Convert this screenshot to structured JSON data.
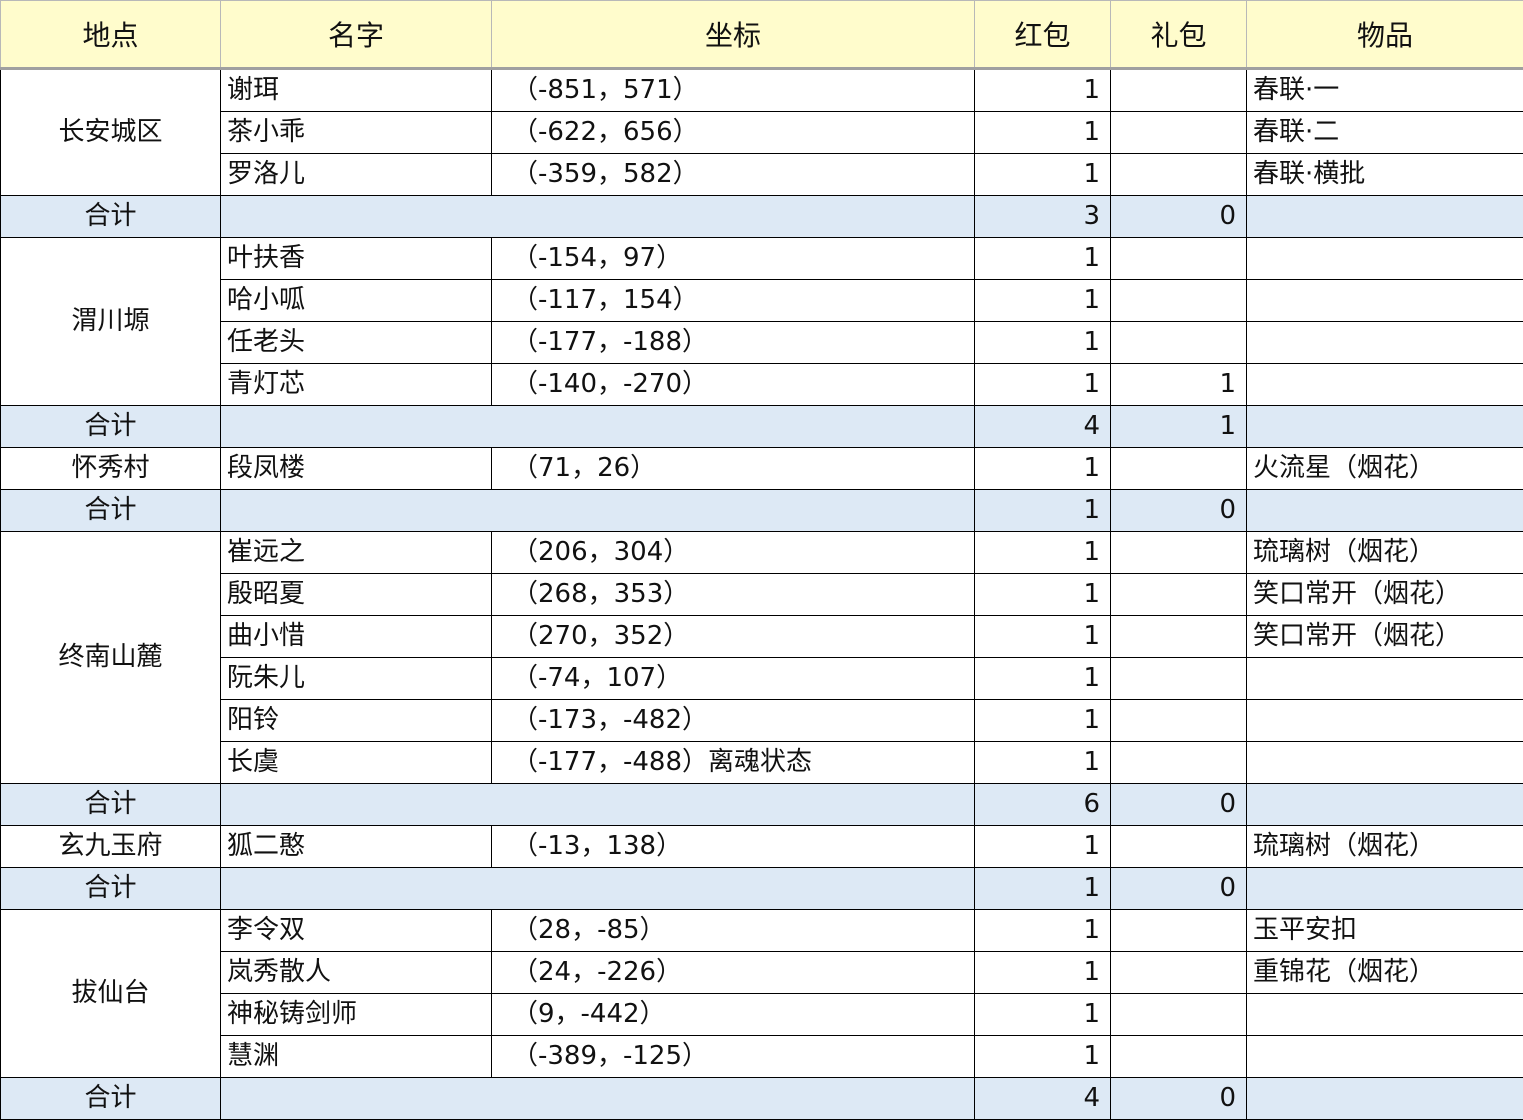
{
  "headers": {
    "location": "地点",
    "name": "名字",
    "coords": "坐标",
    "hongbao": "红包",
    "libao": "礼包",
    "item": "物品"
  },
  "total_label": "合计",
  "colors": {
    "header_bg": "#fffccc",
    "total_bg": "#dde9f5",
    "border": "#000000"
  },
  "groups": [
    {
      "location": "长安城区",
      "rows": [
        {
          "name": "谢珥",
          "coords": "（-851，571）",
          "hongbao": "1",
          "libao": "",
          "item": "春联·一"
        },
        {
          "name": "茶小乖",
          "coords": "（-622，656）",
          "hongbao": "1",
          "libao": "",
          "item": "春联·二"
        },
        {
          "name": "罗洛儿",
          "coords": "（-359，582）",
          "hongbao": "1",
          "libao": "",
          "item": "春联·横批"
        }
      ],
      "total": {
        "hongbao": "3",
        "libao": "0"
      }
    },
    {
      "location": "渭川塬",
      "rows": [
        {
          "name": "叶扶香",
          "coords": "（-154，97）",
          "hongbao": "1",
          "libao": "",
          "item": ""
        },
        {
          "name": "哈小呱",
          "coords": "（-117，154）",
          "hongbao": "1",
          "libao": "",
          "item": ""
        },
        {
          "name": "任老头",
          "coords": "（-177，-188）",
          "hongbao": "1",
          "libao": "",
          "item": ""
        },
        {
          "name": "青灯芯",
          "coords": "（-140，-270）",
          "hongbao": "1",
          "libao": "1",
          "item": ""
        }
      ],
      "total": {
        "hongbao": "4",
        "libao": "1"
      }
    },
    {
      "location": "怀秀村",
      "rows": [
        {
          "name": "段凤楼",
          "coords": "（71，26）",
          "hongbao": "1",
          "libao": "",
          "item": "火流星（烟花）"
        }
      ],
      "total": {
        "hongbao": "1",
        "libao": "0"
      }
    },
    {
      "location": "终南山麓",
      "rows": [
        {
          "name": "崔远之",
          "coords": "（206，304）",
          "hongbao": "1",
          "libao": "",
          "item": "琉璃树（烟花）"
        },
        {
          "name": "殷昭夏",
          "coords": "（268，353）",
          "hongbao": "1",
          "libao": "",
          "item": "笑口常开（烟花）"
        },
        {
          "name": "曲小惜",
          "coords": "（270，352）",
          "hongbao": "1",
          "libao": "",
          "item": "笑口常开（烟花）"
        },
        {
          "name": "阮朱儿",
          "coords": "（-74，107）",
          "hongbao": "1",
          "libao": "",
          "item": ""
        },
        {
          "name": "阳铃",
          "coords": "（-173，-482）",
          "hongbao": "1",
          "libao": "",
          "item": ""
        },
        {
          "name": "长虞",
          "coords": "（-177，-488）离魂状态",
          "hongbao": "1",
          "libao": "",
          "item": ""
        }
      ],
      "total": {
        "hongbao": "6",
        "libao": "0"
      }
    },
    {
      "location": "玄九玉府",
      "rows": [
        {
          "name": "狐二憨",
          "coords": "（-13，138）",
          "hongbao": "1",
          "libao": "",
          "item": "琉璃树（烟花）"
        }
      ],
      "total": {
        "hongbao": "1",
        "libao": "0"
      }
    },
    {
      "location": "拔仙台",
      "rows": [
        {
          "name": "李令双",
          "coords": "（28，-85）",
          "hongbao": "1",
          "libao": "",
          "item": "玉平安扣"
        },
        {
          "name": "岚秀散人",
          "coords": "（24，-226）",
          "hongbao": "1",
          "libao": "",
          "item": "重锦花（烟花）"
        },
        {
          "name": "神秘铸剑师",
          "coords": "（9，-442）",
          "hongbao": "1",
          "libao": "",
          "item": ""
        },
        {
          "name": "慧渊",
          "coords": "（-389，-125）",
          "hongbao": "1",
          "libao": "",
          "item": ""
        }
      ],
      "total": {
        "hongbao": "4",
        "libao": "0"
      }
    }
  ]
}
